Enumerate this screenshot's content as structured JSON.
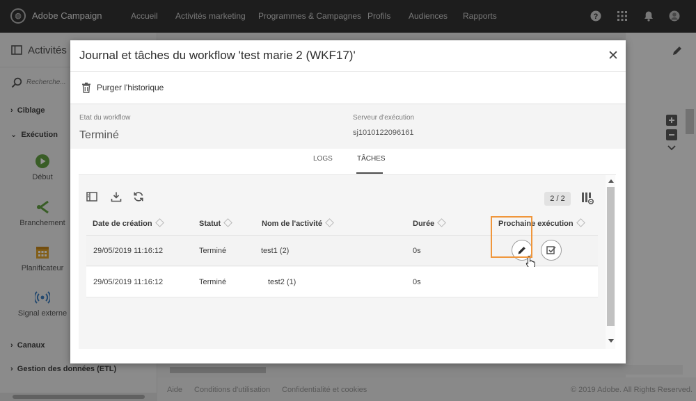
{
  "app": {
    "brand": "Adobe Campaign",
    "nav": [
      "Accueil",
      "Activités marketing",
      "Programmes & Campagnes",
      "Profils",
      "Audiences",
      "Rapports"
    ],
    "icons": [
      "help-icon",
      "apps-grid-icon",
      "notification-bell-icon",
      "user-avatar-icon"
    ]
  },
  "sidebar": {
    "title": "Activités",
    "search_placeholder": "Recherche...",
    "categories": {
      "ciblage": "Ciblage",
      "execution": "Exécution",
      "canaux": "Canaux",
      "gestion": "Gestion des données (ETL)"
    },
    "activities": [
      {
        "label": "Début",
        "icon": "play-icon"
      },
      {
        "label": "Branchement",
        "icon": "fork-icon"
      },
      {
        "label": "Planificateur",
        "icon": "calendar-icon"
      },
      {
        "label": "Signal externe",
        "icon": "signal-icon"
      }
    ]
  },
  "footer": {
    "links": [
      "Aide",
      "Conditions d'utilisation",
      "Confidentialité et cookies"
    ],
    "copyright": "© 2019 Adobe. All Rights Reserved."
  },
  "modal": {
    "title": "Journal et tâches du workflow 'test marie 2 (WKF17)'",
    "close_icon": "close-icon",
    "purge_label": "Purger l'historique",
    "workflow_state_label": "Etat du workflow",
    "workflow_state_value": "Terminé",
    "server_label": "Serveur d'exécution",
    "server_value": "sj1010122096161",
    "tabs": [
      "LOGS",
      "TÂCHES"
    ],
    "active_tab": "TÂCHES",
    "record_count": "2 / 2",
    "columns": [
      "Date de création",
      "Statut",
      "Nom de l'activité",
      "Durée",
      "Prochaine exécution"
    ],
    "rows": [
      {
        "date": "29/05/2019 11:16:12",
        "status": "Terminé",
        "activity": "test1 (2)",
        "duration": "0s"
      },
      {
        "date": "29/05/2019 11:16:12",
        "status": "Terminé",
        "activity": "test2 (1)",
        "duration": "0s"
      }
    ],
    "highlight_color": "#f0963b"
  }
}
